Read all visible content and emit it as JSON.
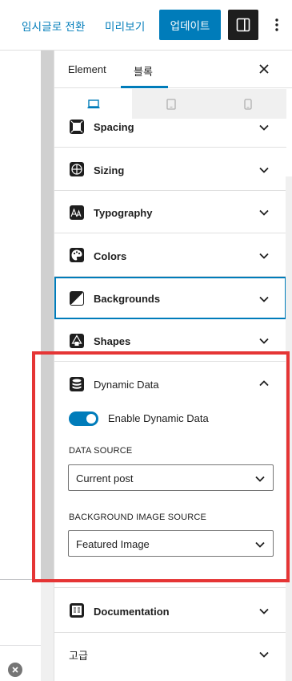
{
  "topbar": {
    "draft_label": "임시글로 전환",
    "preview_label": "미리보기",
    "update_label": "업데이트"
  },
  "sidebar": {
    "tabs": [
      {
        "label": "Element"
      },
      {
        "label": "블록"
      }
    ],
    "panels": {
      "spacing": "Spacing",
      "sizing": "Sizing",
      "typography": "Typography",
      "colors": "Colors",
      "backgrounds": "Backgrounds",
      "shapes": "Shapes",
      "dynamic_data": "Dynamic Data",
      "documentation": "Documentation",
      "advanced": "고급"
    },
    "dynamic": {
      "toggle_label": "Enable Dynamic Data",
      "toggle_on": true,
      "source_label": "DATA SOURCE",
      "source_value": "Current post",
      "bg_source_label": "BACKGROUND IMAGE SOURCE",
      "bg_source_value": "Featured Image"
    }
  },
  "colors": {
    "accent": "#007cba",
    "highlight": "#e53535"
  },
  "icons": [
    "panel-toggle-icon",
    "more-vertical-icon",
    "close-icon",
    "desktop-icon",
    "tablet-icon",
    "mobile-icon",
    "chevron-down-icon",
    "chevron-up-icon"
  ]
}
